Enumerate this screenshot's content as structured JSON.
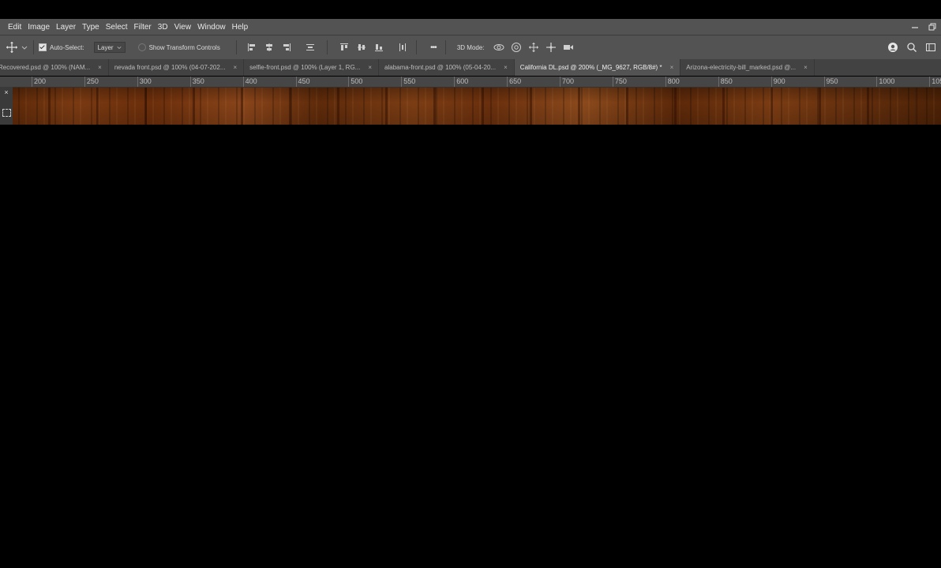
{
  "menu": [
    "Edit",
    "Image",
    "Layer",
    "Type",
    "Select",
    "Filter",
    "3D",
    "View",
    "Window",
    "Help"
  ],
  "options_bar": {
    "auto_select_label": "Auto-Select:",
    "auto_select_checked": true,
    "auto_select_target": "Layer",
    "show_transform_label": "Show Transform Controls",
    "show_transform_checked": false,
    "more_label": "•••",
    "mode_3d_label": "3D Mode:"
  },
  "tabs": [
    {
      "label": "Recovered.psd @ 100% (NAM...",
      "active": false
    },
    {
      "label": "nevada front.psd @ 100% (04-07-202...",
      "active": false
    },
    {
      "label": "selfie-front.psd @ 100% (Layer 1, RG...",
      "active": false
    },
    {
      "label": "alabama-front.psd @ 100% (05-04-20...",
      "active": false
    },
    {
      "label": "California DL.psd @ 200% (_MG_9627, RGB/8#) *",
      "active": true
    },
    {
      "label": "Arizona-electricity-bill_marked.psd @...",
      "active": false
    }
  ],
  "tab_close_glyph": "×",
  "ruler": {
    "labels": [
      "200",
      "250",
      "300",
      "350",
      "400",
      "450",
      "500",
      "550",
      "600",
      "650",
      "700",
      "750",
      "800",
      "850",
      "900",
      "950",
      "1000",
      "105"
    ]
  },
  "panel_close_glyph": "×",
  "icons": {
    "move_tool": "move-icon",
    "search": "search-icon",
    "workspace": "workspace-icon",
    "account": "account-icon"
  },
  "colors": {
    "chrome": "#535353",
    "tabbar": "#424242",
    "active_tab": "#535353",
    "canvas_wood": "#6b2e0b"
  }
}
